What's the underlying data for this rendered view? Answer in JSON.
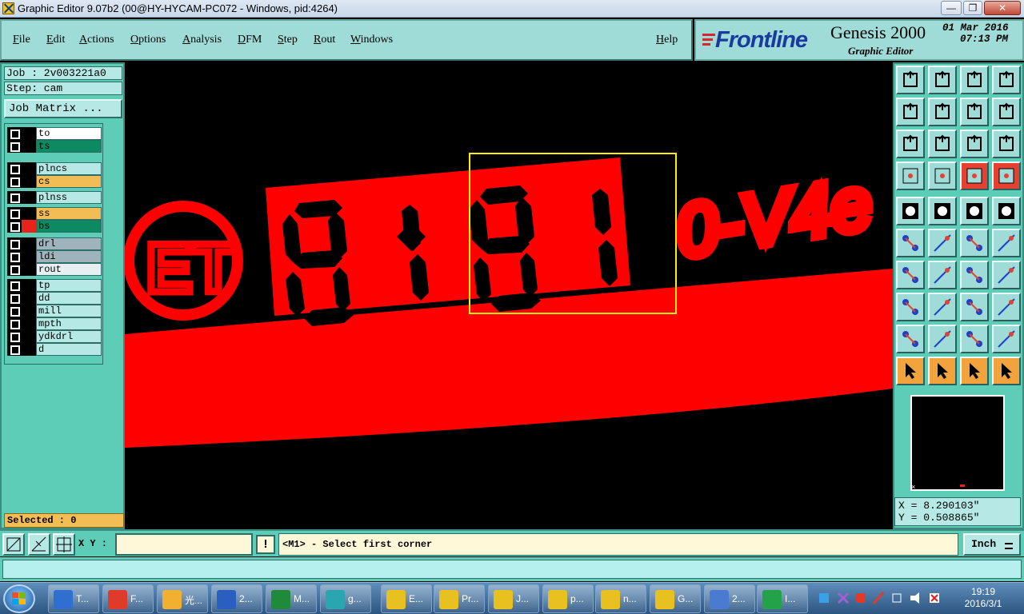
{
  "window": {
    "title": "Graphic Editor 9.07b2 (00@HY-HYCAM-PC072 - Windows, pid:4264)"
  },
  "menu": {
    "items": [
      "File",
      "Edit",
      "Actions",
      "Options",
      "Analysis",
      "DFM",
      "Step",
      "Rout",
      "Windows"
    ],
    "help": "Help"
  },
  "brand": {
    "logo": "Frontline",
    "product": "Genesis 2000",
    "subtitle": "Graphic Editor",
    "date": "01 Mar 2016",
    "time": "07:13 PM"
  },
  "job": {
    "job_label": "Job : 2v003221a0",
    "step_label": "Step: cam",
    "matrix_button": "Job Matrix ..."
  },
  "layers": [
    {
      "name": "to",
      "swatch": "#000000",
      "bg": "#ffffff"
    },
    {
      "name": "ts",
      "swatch": "#000000",
      "bg": "#0e8a63"
    },
    {
      "name": "plncs",
      "swatch": "#000000",
      "bg": "#b6e9e6"
    },
    {
      "name": "cs",
      "swatch": "#000000",
      "bg": "#f3bd55"
    },
    {
      "name": "plnss",
      "swatch": "#000000",
      "bg": "#b6e9e6"
    },
    {
      "name": "ss",
      "swatch": "#000000",
      "bg": "#f3bd55"
    },
    {
      "name": "bs",
      "swatch": "#e8231c",
      "bg": "#0e8a63"
    },
    {
      "name": "drl",
      "swatch": "#000000",
      "bg": "#9fb3bd"
    },
    {
      "name": "ldi",
      "swatch": "#000000",
      "bg": "#9fb3bd"
    },
    {
      "name": "rout",
      "swatch": "#000000",
      "bg": "#e6f0f2"
    },
    {
      "name": "tp",
      "swatch": "#000000",
      "bg": "#b6e9e6"
    },
    {
      "name": "dd",
      "swatch": "#000000",
      "bg": "#b6e9e6"
    },
    {
      "name": "mill",
      "swatch": "#000000",
      "bg": "#b6e9e6"
    },
    {
      "name": "mpth",
      "swatch": "#000000",
      "bg": "#b6e9e6"
    },
    {
      "name": "ydkdrl",
      "swatch": "#000000",
      "bg": "#b6e9e6"
    },
    {
      "name": "d",
      "swatch": "#000000",
      "bg": "#b6e9e6"
    }
  ],
  "selected": "Selected : 0",
  "coords": {
    "x": "X = 8.290103\"",
    "y": "Y = 0.508865\""
  },
  "bottom": {
    "xy_label": "X Y :",
    "xy_value": "",
    "excl": "!",
    "prompt": "<M1> - Select first corner",
    "units": "Inch"
  },
  "canvas": {
    "board_color": "#ff0000",
    "highlight_color": "#ffee00",
    "marking": "0-V4e",
    "logo_text": "ET"
  },
  "taskbar": {
    "items": [
      {
        "label": "T...",
        "icon": "floppy-icon",
        "color": "#2f6fcf"
      },
      {
        "label": "F...",
        "icon": "app-g-icon",
        "color": "#e03a2a"
      },
      {
        "label": "光...",
        "icon": "shell-icon",
        "color": "#f2b030"
      },
      {
        "label": "2...",
        "icon": "word-icon",
        "color": "#2b5fbf"
      },
      {
        "label": "M...",
        "icon": "excel-icon",
        "color": "#1f8a3a"
      },
      {
        "label": "g...",
        "icon": "eye-icon",
        "color": "#2aa6b0"
      },
      {
        "label": "E...",
        "icon": "genesis-icon",
        "color": "#e8c020"
      },
      {
        "label": "Pr...",
        "icon": "genesis-icon",
        "color": "#e8c020"
      },
      {
        "label": "J...",
        "icon": "genesis-icon",
        "color": "#e8c020"
      },
      {
        "label": "p...",
        "icon": "genesis-icon",
        "color": "#e8c020"
      },
      {
        "label": "n...",
        "icon": "genesis-icon",
        "color": "#e8c020"
      },
      {
        "label": "G...",
        "icon": "genesis-icon",
        "color": "#e8c020"
      },
      {
        "label": "2...",
        "icon": "doc-a-icon",
        "color": "#4a7bd0"
      },
      {
        "label": "I...",
        "icon": "app-p-icon",
        "color": "#24a24a"
      }
    ],
    "clock_time": "19:19",
    "clock_date": "2016/3/1"
  }
}
